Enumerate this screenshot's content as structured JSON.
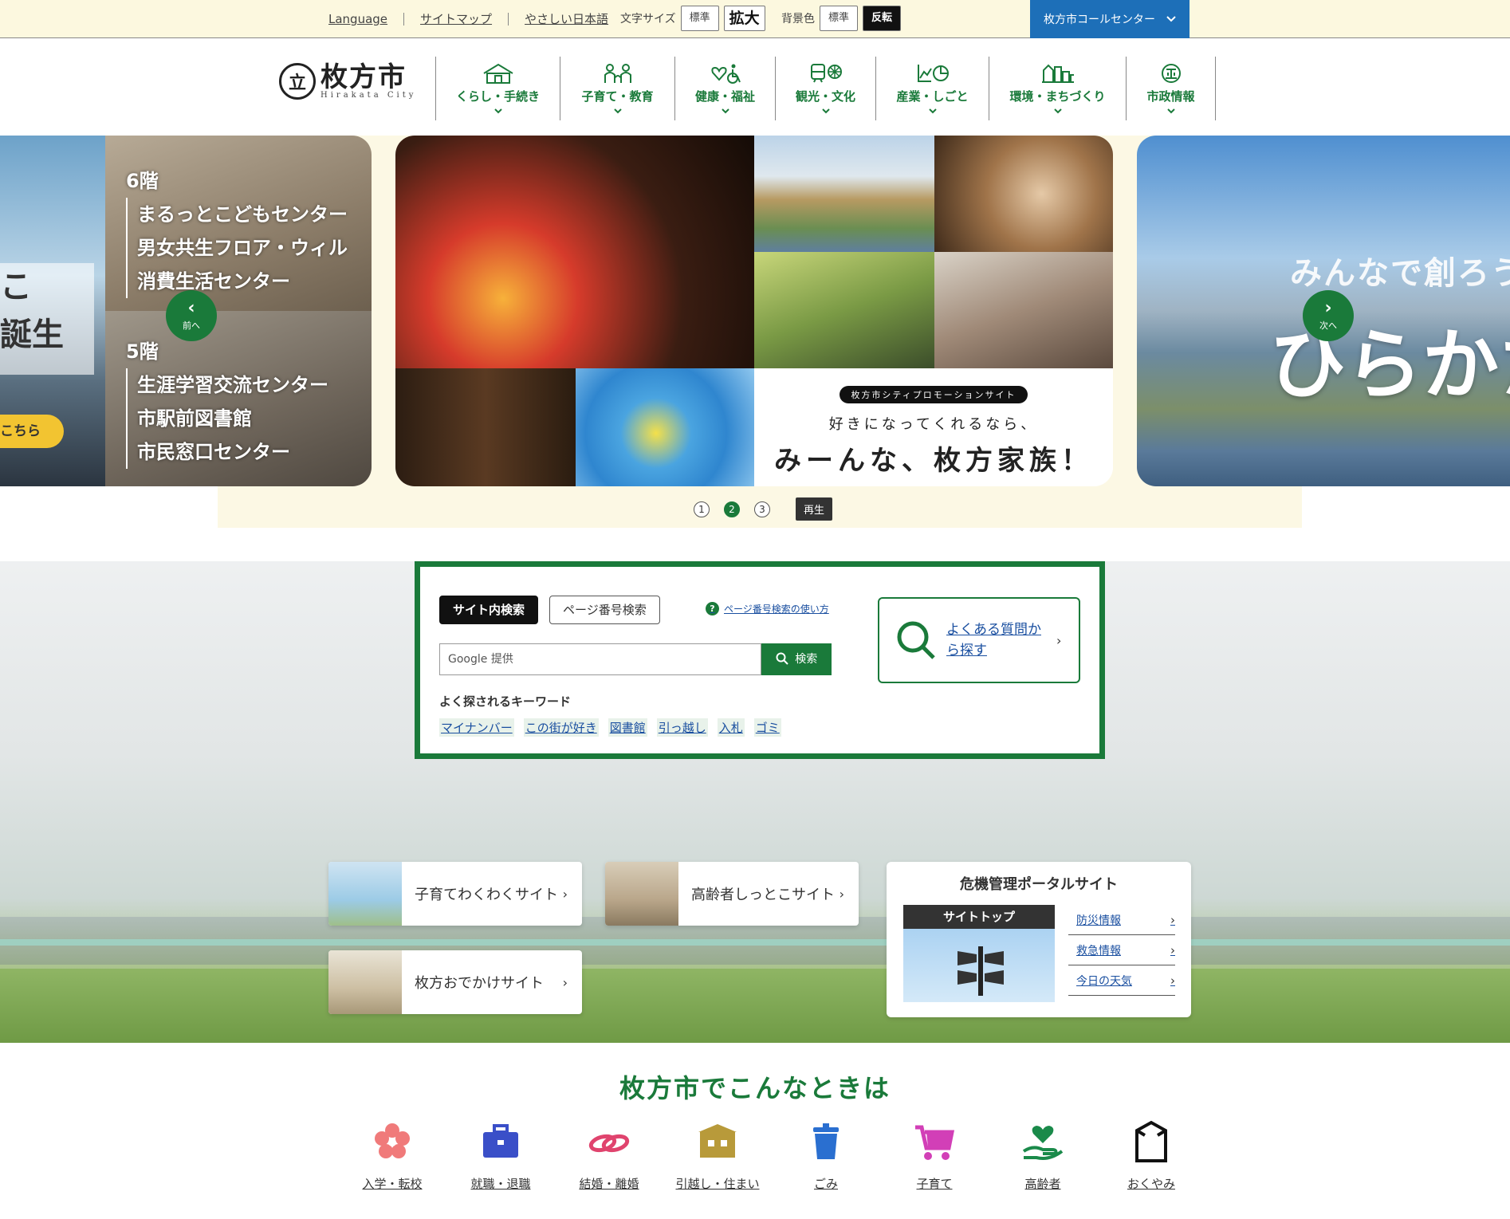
{
  "util": {
    "links": [
      "Language",
      "サイトマップ",
      "やさしい日本語"
    ],
    "fontsize_label": "文字サイズ",
    "fontsize_normal": "標準",
    "fontsize_large": "拡大",
    "bg_label": "背景色",
    "bg_normal": "標準",
    "bg_invert": "反転",
    "callcenter": "枚方市コールセンター"
  },
  "logo": {
    "jp": "枚方市",
    "en": "Hirakata City"
  },
  "gnav": [
    {
      "label": "くらし・手続き",
      "icon": "house-icon"
    },
    {
      "label": "子育て・教育",
      "icon": "family-icon"
    },
    {
      "label": "健康・福祉",
      "icon": "heart-wheelchair-icon"
    },
    {
      "label": "観光・文化",
      "icon": "train-icon"
    },
    {
      "label": "産業・しごと",
      "icon": "chart-icon"
    },
    {
      "label": "環境・まちづくり",
      "icon": "buildings-icon"
    },
    {
      "label": "市政情報",
      "icon": "city-emblem-icon"
    }
  ],
  "hero": {
    "left": {
      "partial_text": "こ",
      "partial_text2": "が誕生",
      "cta": "こちら",
      "floor6": {
        "title": "6階",
        "items": [
          "まるっとこどもセンター",
          "男女共生フロア・ウィル",
          "消費生活センター"
        ]
      },
      "floor5": {
        "title": "5階",
        "items": [
          "生涯学習交流センター",
          "市駅前図書館",
          "市民窓口センター"
        ]
      }
    },
    "center": {
      "badge": "枚方市シティプロモーションサイト",
      "line1": "好きになってくれるなら、",
      "line2": "みーんな、枚方家族！"
    },
    "right": {
      "text1": "みんなで創ろう",
      "text2": "ひらかた"
    },
    "prev_label": "前へ",
    "next_label": "次へ",
    "dots": [
      "1",
      "2",
      "3"
    ],
    "active_dot": 2,
    "play_label": "再生"
  },
  "search": {
    "tab_site": "サイト内検索",
    "tab_page": "ページ番号検索",
    "help": "ページ番号検索の使い方",
    "placeholder": "Google 提供",
    "button": "検索",
    "keywords_title": "よく探されるキーワード",
    "keywords": [
      "マイナンバー",
      "この街が好き",
      "図書館",
      "引っ越し",
      "入札",
      "ゴミ"
    ],
    "faq": "よくある質問から探す"
  },
  "cards": [
    {
      "label": "子育てわくわくサイト"
    },
    {
      "label": "高齢者しっとこサイト"
    },
    {
      "label": "枚方おでかけサイト"
    }
  ],
  "crisis": {
    "title": "危機管理ポータルサイト",
    "top_label": "サイトトップ",
    "links": [
      "防災情報",
      "救急情報",
      "今日の天気"
    ]
  },
  "konna": {
    "title": "枚方市でこんなときは",
    "items": [
      {
        "label": "入学・転校",
        "icon": "sakura-icon",
        "color": "#f07a7a"
      },
      {
        "label": "就職・退職",
        "icon": "briefcase-icon",
        "color": "#3a4fc8"
      },
      {
        "label": "結婚・離婚",
        "icon": "rings-icon",
        "color": "#e0446e"
      },
      {
        "label": "引越し・住まい",
        "icon": "house-box-icon",
        "color": "#b89a3a"
      },
      {
        "label": "ごみ",
        "icon": "trash-icon",
        "color": "#2a6fd0"
      },
      {
        "label": "子育て",
        "icon": "stroller-icon",
        "color": "#d23fb7"
      },
      {
        "label": "高齢者",
        "icon": "heart-hand-icon",
        "color": "#1a8a4a"
      },
      {
        "label": "おくやみ",
        "icon": "frame-icon",
        "color": "#111111"
      }
    ]
  }
}
